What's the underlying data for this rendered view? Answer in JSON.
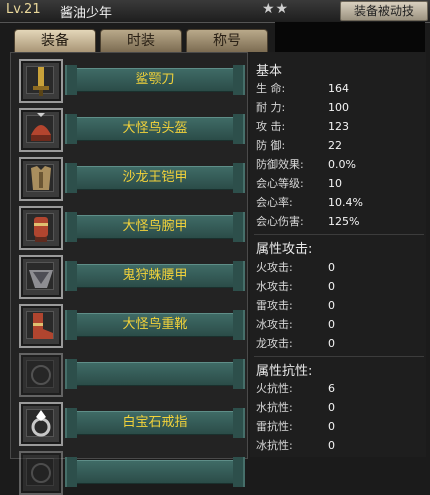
{
  "header": {
    "level": "Lv.21",
    "player_name": "酱油少年",
    "stars": "★★",
    "action_button": "装备被动技"
  },
  "tabs": [
    "装备",
    "时装",
    "称号"
  ],
  "equipment": [
    {
      "name": "鲨颚刀",
      "icon": "sword-icon"
    },
    {
      "name": "大怪鸟头盔",
      "icon": "helmet-icon"
    },
    {
      "name": "沙龙王铠甲",
      "icon": "armor-icon"
    },
    {
      "name": "大怪鸟腕甲",
      "icon": "gauntlet-icon"
    },
    {
      "name": "鬼狩蛛腰甲",
      "icon": "waist-icon"
    },
    {
      "name": "大怪鸟重靴",
      "icon": "boots-icon"
    },
    {
      "name": "",
      "icon": "empty-slot-icon"
    },
    {
      "name": "白宝石戒指",
      "icon": "ring-icon"
    },
    {
      "name": "",
      "icon": "empty-slot-icon"
    }
  ],
  "stats": {
    "basic_title": "基本",
    "basic": [
      {
        "key": "生 命:",
        "value": "164"
      },
      {
        "key": "耐 力:",
        "value": "100"
      },
      {
        "key": "攻 击:",
        "value": "123"
      },
      {
        "key": "防 御:",
        "value": "22"
      },
      {
        "key": "防御效果:",
        "value": "0.0%"
      },
      {
        "key": "会心等级:",
        "value": "10"
      },
      {
        "key": "会心率:",
        "value": "10.4%"
      },
      {
        "key": "会心伤害:",
        "value": "125%"
      }
    ],
    "attack_title": "属性攻击:",
    "attack": [
      {
        "key": "火攻击:",
        "value": "0"
      },
      {
        "key": "水攻击:",
        "value": "0"
      },
      {
        "key": "雷攻击:",
        "value": "0"
      },
      {
        "key": "冰攻击:",
        "value": "0"
      },
      {
        "key": "龙攻击:",
        "value": "0"
      }
    ],
    "resist_title": "属性抗性:",
    "resist": [
      {
        "key": "火抗性:",
        "value": "6"
      },
      {
        "key": "水抗性:",
        "value": "0"
      },
      {
        "key": "雷抗性:",
        "value": "0"
      },
      {
        "key": "冰抗性:",
        "value": "0"
      }
    ]
  }
}
